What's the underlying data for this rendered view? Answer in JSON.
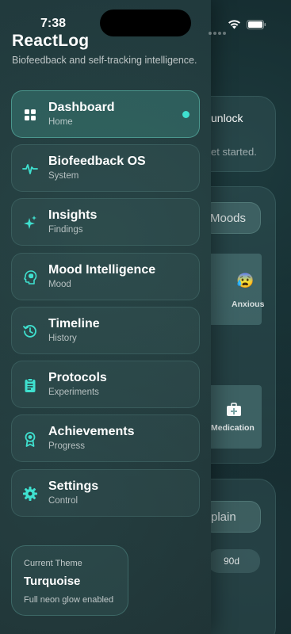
{
  "status_bar": {
    "time": "7:38"
  },
  "app": {
    "title": "ReactLog",
    "tagline": "Biofeedback and self-tracking intelligence."
  },
  "nav": {
    "items": [
      {
        "label": "Dashboard",
        "sub": "Home",
        "icon": "grid-icon",
        "active": true
      },
      {
        "label": "Biofeedback OS",
        "sub": "System",
        "icon": "pulse-icon",
        "active": false
      },
      {
        "label": "Insights",
        "sub": "Findings",
        "icon": "sparkle-icon",
        "active": false
      },
      {
        "label": "Mood Intelligence",
        "sub": "Mood",
        "icon": "brain-head-icon",
        "active": false
      },
      {
        "label": "Timeline",
        "sub": "History",
        "icon": "history-icon",
        "active": false
      },
      {
        "label": "Protocols",
        "sub": "Experiments",
        "icon": "clipboard-icon",
        "active": false
      },
      {
        "label": "Achievements",
        "sub": "Progress",
        "icon": "award-icon",
        "active": false
      },
      {
        "label": "Settings",
        "sub": "Control",
        "icon": "gear-icon",
        "active": false
      }
    ]
  },
  "theme": {
    "title": "Current Theme",
    "name": "Turquoise",
    "description": "Full neon glow enabled"
  },
  "background": {
    "card1_title": "unlock",
    "card1_text": "et started.",
    "moods_button": "Moods",
    "mood_label": "Anxious",
    "medication_label": "Medication",
    "explain_button": "plain",
    "range_pill": "90d"
  },
  "colors": {
    "accent": "#3fe0cf",
    "drawer_bg": "#22393b"
  }
}
